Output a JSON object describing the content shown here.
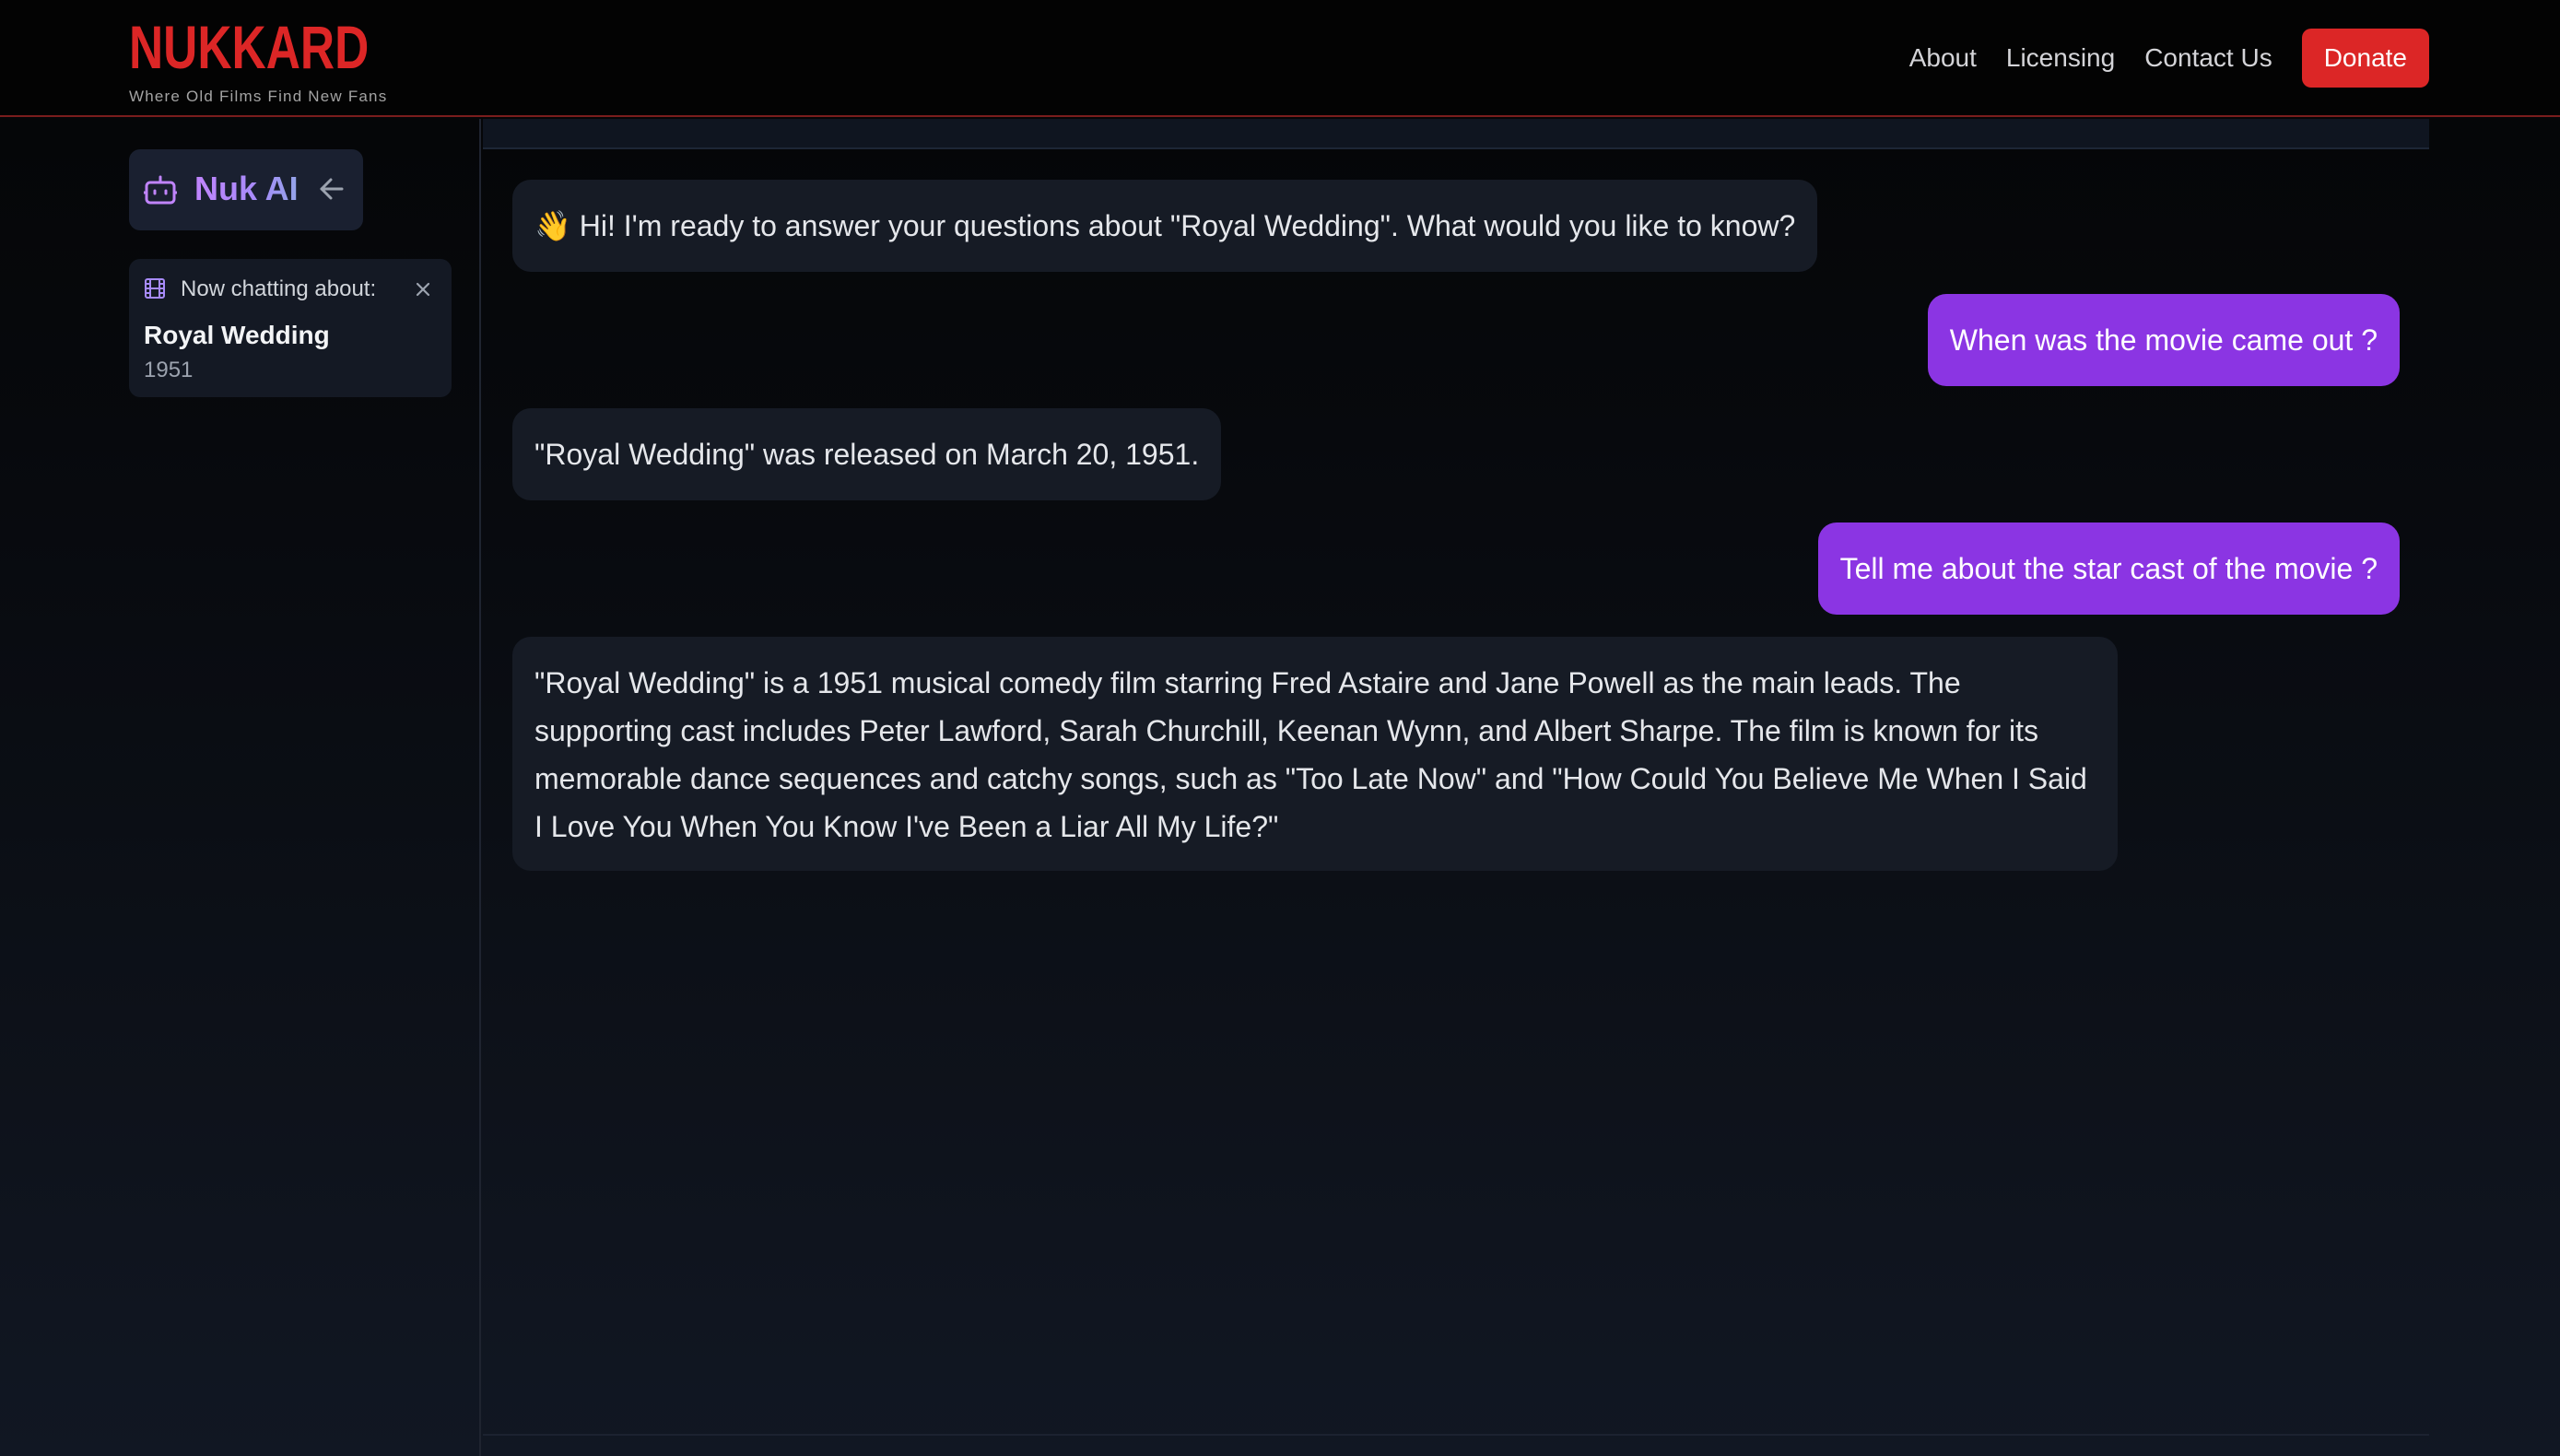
{
  "header": {
    "brand": "NUKKARD",
    "tagline": "Where Old Films Find New Fans",
    "nav": {
      "about": "About",
      "licensing": "Licensing",
      "contact": "Contact Us",
      "donate": "Donate"
    }
  },
  "sidebar": {
    "assistant_title": "Nuk AI",
    "assistant_icon": "robot-icon",
    "back_icon": "arrow-left-icon",
    "context": {
      "label": "Now chatting about:",
      "icon": "film-icon",
      "close_icon": "close-icon",
      "movie_title": "Royal Wedding",
      "movie_year": "1951"
    }
  },
  "chat": {
    "messages": [
      {
        "role": "assistant",
        "text": "👋 Hi! I'm ready to answer your questions about \"Royal Wedding\". What would you like to know?"
      },
      {
        "role": "user",
        "text": "When was the movie came out ?"
      },
      {
        "role": "assistant",
        "text": "\"Royal Wedding\" was released on March 20, 1951."
      },
      {
        "role": "user",
        "text": "Tell me about the star cast of the movie ?"
      },
      {
        "role": "assistant",
        "text": "\"Royal Wedding\" is a 1951 musical comedy film starring Fred Astaire and Jane Powell as the main leads. The supporting cast includes Peter Lawford, Sarah Churchill, Keenan Wynn, and Albert Sharpe. The film is known for its memorable dance sequences and catchy songs, such as \"Too Late Now\" and \"How Could You Believe Me When I Said I Love You When You Know I've Been a Liar All My Life?\""
      }
    ]
  },
  "colors": {
    "brand_red": "#dc2626",
    "user_bubble": "#8b35e3",
    "bot_bubble": "#161b25",
    "ai_accent": "#c084fc"
  }
}
